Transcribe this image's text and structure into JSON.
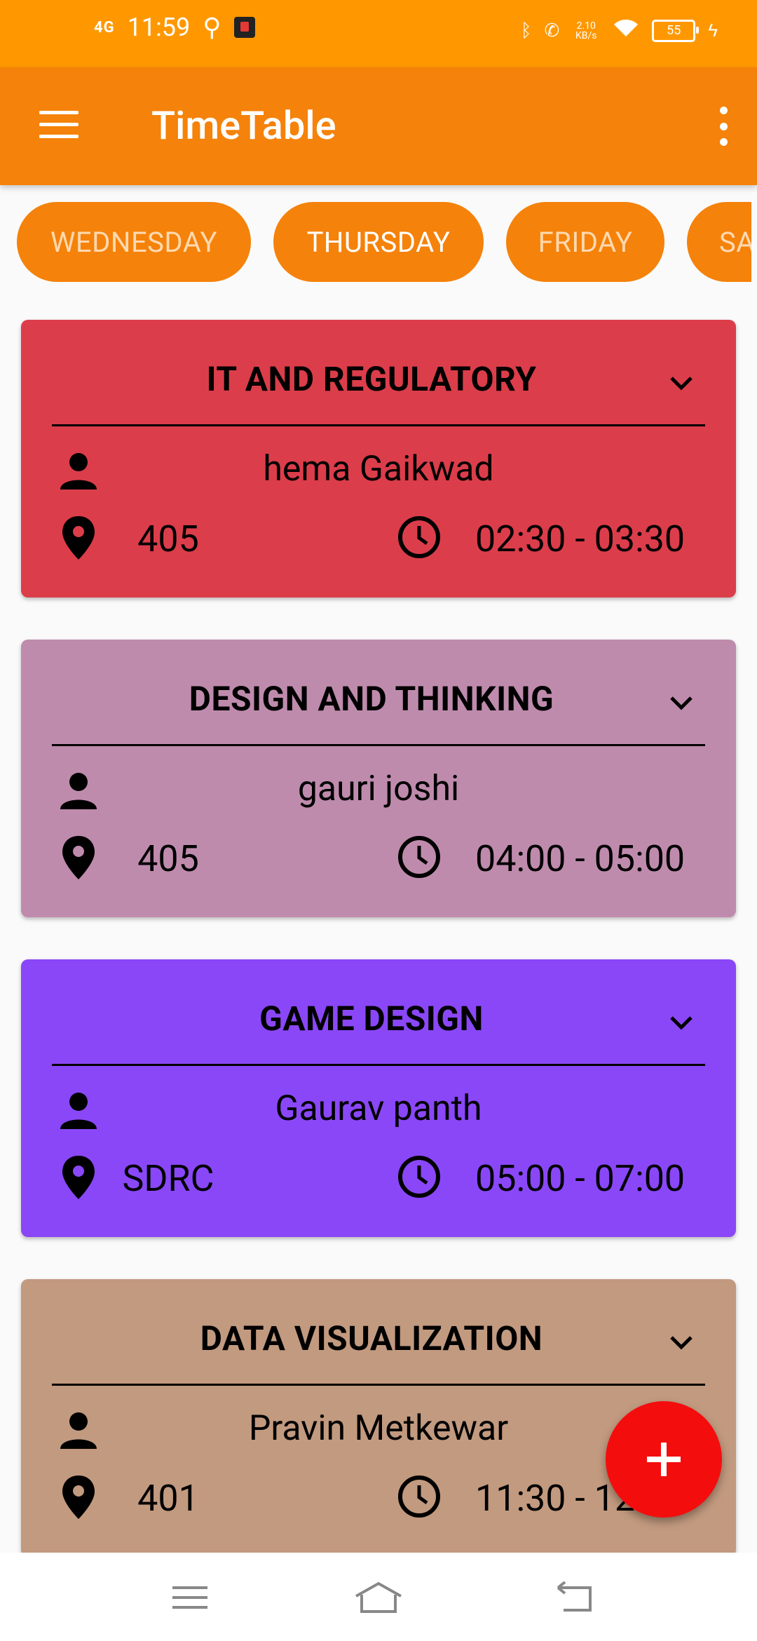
{
  "status_bar": {
    "network": "4G",
    "time": "11:59",
    "speed": "2.10 KB/s",
    "battery": "55"
  },
  "app_bar": {
    "title": "TimeTable"
  },
  "days": [
    "WEDNESDAY",
    "THURSDAY",
    "FRIDAY",
    "SA"
  ],
  "active_day": "THURSDAY",
  "lectures": [
    {
      "subject": "IT AND REGULATORY",
      "teacher": "hema Gaikwad",
      "room": "405",
      "time": "02:30 - 03:30",
      "color": "#dc3d4a"
    },
    {
      "subject": "DESIGN AND THINKING",
      "teacher": "gauri joshi",
      "room": "405",
      "time": "04:00 - 05:00",
      "color": "#bf8bad"
    },
    {
      "subject": "GAME DESIGN",
      "teacher": "Gaurav panth",
      "room": "SDRC",
      "time": "05:00 - 07:00",
      "color": "#8a47f8"
    },
    {
      "subject": "DATA VISUALIZATION",
      "teacher": "Pravin Metkewar",
      "room": "401",
      "time": "11:30 - 12",
      "color": "#c29a7f"
    }
  ],
  "theme": {
    "status_bar": "#ff9800",
    "app_bar": "#f5820a",
    "fab": "#f40d0d"
  },
  "icons": {
    "menu": "menu-icon",
    "more": "more-vert-icon",
    "person": "person-icon",
    "location": "location-pin-icon",
    "clock": "clock-icon",
    "expand": "chevron-down-icon",
    "add": "plus-icon"
  }
}
